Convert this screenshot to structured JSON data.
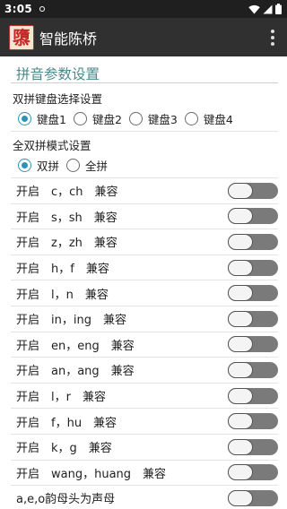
{
  "status_bar": {
    "time": "3:05"
  },
  "app": {
    "logo_char": "隳",
    "title": "智能陈桥"
  },
  "section_title": "拼音参数设置",
  "keyboard_group": {
    "label": "双拼键盘选择设置",
    "options": [
      "键盘1",
      "键盘2",
      "键盘3",
      "键盘4"
    ],
    "selected": "键盘1"
  },
  "mode_group": {
    "label": "全双拼模式设置",
    "options": [
      "双拼",
      "全拼"
    ],
    "selected": "双拼"
  },
  "settings": [
    {
      "label": "开启　c，ch　兼容",
      "enabled": false
    },
    {
      "label": "开启　s，sh　兼容",
      "enabled": false
    },
    {
      "label": "开启　z，zh　兼容",
      "enabled": false
    },
    {
      "label": "开启　h，f　兼容",
      "enabled": false
    },
    {
      "label": "开启　l，n　兼容",
      "enabled": false
    },
    {
      "label": "开启　in，ing　兼容",
      "enabled": false
    },
    {
      "label": "开启　en，eng　兼容",
      "enabled": false
    },
    {
      "label": "开启　an，ang　兼容",
      "enabled": false
    },
    {
      "label": "开启　l，r　兼容",
      "enabled": false
    },
    {
      "label": "开启　f，hu　兼容",
      "enabled": false
    },
    {
      "label": "开启　k，g　兼容",
      "enabled": false
    },
    {
      "label": "开启　wang，huang　兼容",
      "enabled": false
    },
    {
      "label": "a,e,o韵母头为声母",
      "enabled": false
    }
  ]
}
